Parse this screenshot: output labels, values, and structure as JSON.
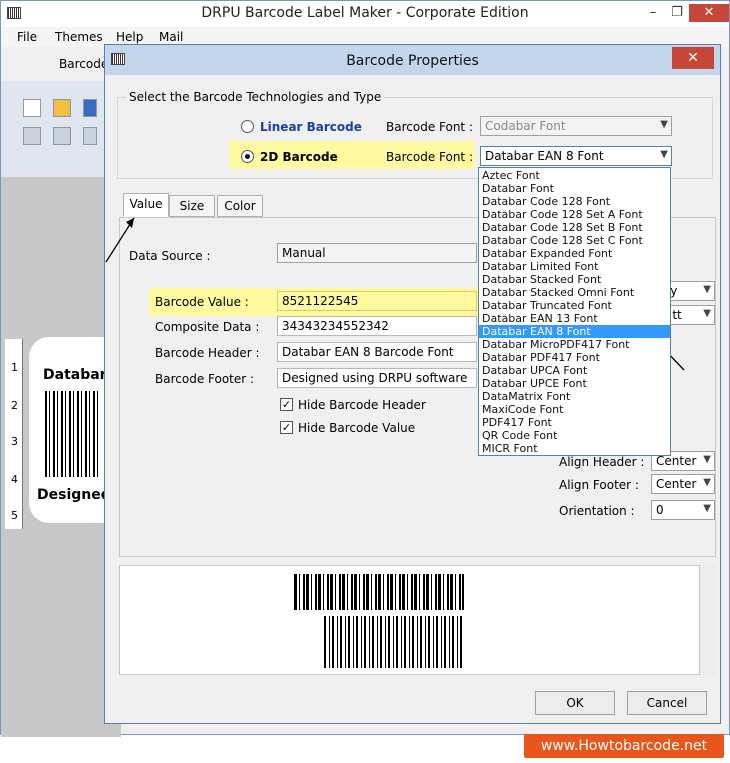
{
  "app": {
    "title": "DRPU Barcode Label Maker - Corporate Edition",
    "menu": [
      "File",
      "Themes",
      "Help",
      "Mail"
    ],
    "ribbon_tab": "Barcode",
    "canvas_label": {
      "header_text": "Databar",
      "footer_text": "Designed",
      "ruler_numbers": [
        "1",
        "2",
        "3",
        "4",
        "5"
      ]
    }
  },
  "dialog": {
    "title": "Barcode Properties",
    "tech_group_legend": "Select the Barcode Technologies and Type",
    "linear": {
      "label": "Linear Barcode",
      "font_label": "Barcode Font :",
      "font_value": "Codabar Font",
      "selected": false
    },
    "twod": {
      "label": "2D Barcode",
      "font_label": "Barcode Font :",
      "font_value": "Databar EAN 8 Font",
      "selected": true
    },
    "tabs": [
      "Value",
      "Size",
      "Color"
    ],
    "active_tab": "Value",
    "data_source": {
      "label": "Data Source :",
      "value": "Manual"
    },
    "fields": {
      "barcode_value": {
        "label": "Barcode Value :",
        "value": "8521122545"
      },
      "composite_data": {
        "label": "Composite Data :",
        "value": "34343234552342"
      },
      "barcode_header": {
        "label": "Barcode Header :",
        "value": "Databar EAN 8 Barcode Font"
      },
      "barcode_footer": {
        "label": "Barcode Footer :",
        "value": "Designed using DRPU software"
      }
    },
    "checkboxes": {
      "hide_header": {
        "label": "Hide Barcode Header",
        "checked": true
      },
      "hide_value": {
        "label": "Hide Barcode Value",
        "checked": true
      }
    },
    "right_combos": {
      "date_fragment": "yyy",
      "time_fragment": "ss tt"
    },
    "align_header": {
      "label": "Align Header :",
      "value": "Center"
    },
    "align_footer": {
      "label": "Align Footer :",
      "value": "Center"
    },
    "orientation": {
      "label": "Orientation :",
      "value": "0"
    },
    "font_list": {
      "items": [
        "Aztec Font",
        "Databar Font",
        "Databar Code 128 Font",
        "Databar Code 128 Set A Font",
        "Databar Code 128 Set B Font",
        "Databar Code 128 Set C Font",
        "Databar Expanded Font",
        "Databar Limited Font",
        "Databar Stacked Font",
        "Databar Stacked Omni Font",
        "Databar Truncated Font",
        "Databar EAN 13 Font",
        "Databar EAN 8 Font",
        "Databar MicroPDF417 Font",
        "Databar PDF417 Font",
        "Databar UPCA Font",
        "Databar UPCE Font",
        "DataMatrix Font",
        "MaxiCode Font",
        "PDF417 Font",
        "QR Code Font",
        "MICR Font"
      ],
      "selected_index": 12
    },
    "ok_label": "OK",
    "cancel_label": "Cancel"
  },
  "branding": {
    "site": "www.Howtobarcode.net"
  },
  "colors": {
    "highlight": "#fff9a0",
    "selection": "#3399ff",
    "brand": "#e8561c",
    "linear_label": "#1a3fa8"
  }
}
